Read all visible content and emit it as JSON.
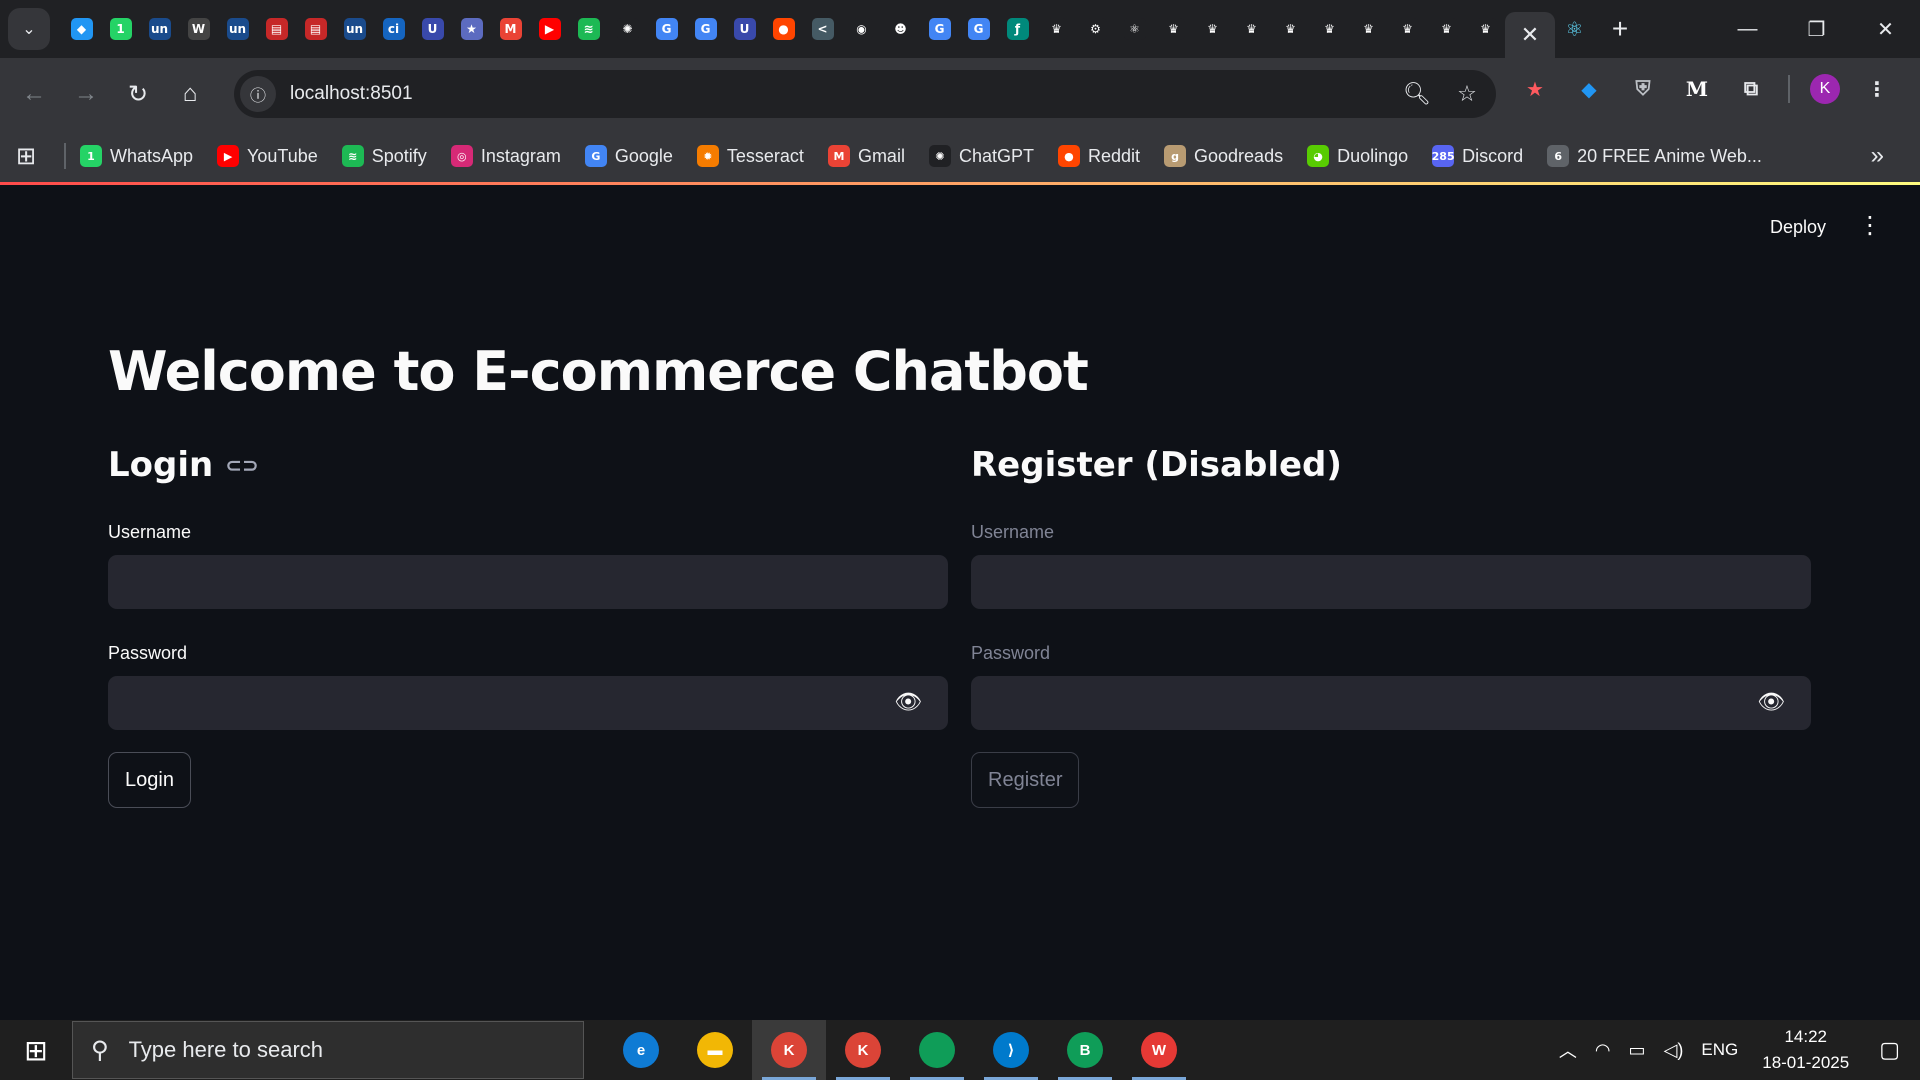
{
  "browser": {
    "pinned_tabs": [
      {
        "icon": "gem-icon",
        "glyph": "◆",
        "color": "#2196f3"
      },
      {
        "icon": "whatsapp-icon",
        "glyph": "1",
        "color": "#25d366"
      },
      {
        "icon": "un-icon",
        "glyph": "un",
        "color": "#1a4b8c"
      },
      {
        "icon": "wordpress-icon",
        "glyph": "W",
        "color": "#444"
      },
      {
        "icon": "un-icon",
        "glyph": "un",
        "color": "#1a4b8c"
      },
      {
        "icon": "doc-icon",
        "glyph": "▤",
        "color": "#c62828"
      },
      {
        "icon": "doc-icon",
        "glyph": "▤",
        "color": "#c62828"
      },
      {
        "icon": "un-icon",
        "glyph": "un",
        "color": "#1a4b8c"
      },
      {
        "icon": "citi-icon",
        "glyph": "ci",
        "color": "#1565c0"
      },
      {
        "icon": "bookmark-icon",
        "glyph": "U",
        "color": "#3949ab"
      },
      {
        "icon": "star-icon",
        "glyph": "★",
        "color": "#5c6bc0"
      },
      {
        "icon": "gmail-icon",
        "glyph": "M",
        "color": "#ea4335"
      },
      {
        "icon": "youtube-icon",
        "glyph": "▶",
        "color": "#ff0000"
      },
      {
        "icon": "spotify-icon",
        "glyph": "≋",
        "color": "#1db954"
      },
      {
        "icon": "chatgpt-icon",
        "glyph": "✺",
        "color": "#202124"
      },
      {
        "icon": "google-icon",
        "glyph": "G",
        "color": "#4285f4"
      },
      {
        "icon": "google-icon",
        "glyph": "G",
        "color": "#4285f4"
      },
      {
        "icon": "bookmark-icon",
        "glyph": "U",
        "color": "#3949ab"
      },
      {
        "icon": "reddit-icon",
        "glyph": "●",
        "color": "#ff4500"
      },
      {
        "icon": "share-icon",
        "glyph": "<",
        "color": "#455a64"
      },
      {
        "icon": "github-icon",
        "glyph": "◉",
        "color": "#202124"
      },
      {
        "icon": "lion-icon",
        "glyph": "☻",
        "color": "#202124"
      },
      {
        "icon": "google-icon",
        "glyph": "G",
        "color": "#4285f4"
      },
      {
        "icon": "google-icon",
        "glyph": "G",
        "color": "#4285f4"
      },
      {
        "icon": "feather-icon",
        "glyph": "ƒ",
        "color": "#00897b"
      },
      {
        "icon": "crown-icon",
        "glyph": "♛",
        "color": "#202124"
      },
      {
        "icon": "gear-icon",
        "glyph": "⚙",
        "color": "#202124"
      },
      {
        "icon": "react-icon",
        "glyph": "⚛",
        "color": "#202124"
      },
      {
        "icon": "crown-icon",
        "glyph": "♛",
        "color": "#202124"
      },
      {
        "icon": "crown-icon",
        "glyph": "♛",
        "color": "#202124"
      },
      {
        "icon": "crown-icon",
        "glyph": "♛",
        "color": "#202124"
      },
      {
        "icon": "crown-icon",
        "glyph": "♛",
        "color": "#202124"
      },
      {
        "icon": "crown-icon",
        "glyph": "♛",
        "color": "#202124"
      },
      {
        "icon": "crown-icon",
        "glyph": "♛",
        "color": "#202124"
      },
      {
        "icon": "crown-icon",
        "glyph": "♛",
        "color": "#202124"
      },
      {
        "icon": "crown-icon",
        "glyph": "♛",
        "color": "#202124"
      },
      {
        "icon": "crown-icon",
        "glyph": "♛",
        "color": "#202124"
      }
    ],
    "active_tab_close_glyph": "✕",
    "next_tab_glyph": "⚛",
    "new_tab_glyph": "+",
    "window": {
      "minimize": "—",
      "restore": "❐",
      "close": "✕"
    },
    "url": "localhost:8501",
    "extensions": [
      "★",
      "◆",
      "⛨",
      "M",
      "⧉"
    ],
    "profile_initial": "K",
    "bookmarks": [
      {
        "label": "WhatsApp",
        "glyph": "1",
        "color": "#25d366"
      },
      {
        "label": "YouTube",
        "glyph": "▶",
        "color": "#ff0000"
      },
      {
        "label": "Spotify",
        "glyph": "≋",
        "color": "#1db954"
      },
      {
        "label": "Instagram",
        "glyph": "◎",
        "color": "#d62976"
      },
      {
        "label": "Google",
        "glyph": "G",
        "color": "#4285f4"
      },
      {
        "label": "Tesseract",
        "glyph": "✹",
        "color": "#f57c00"
      },
      {
        "label": "Gmail",
        "glyph": "M",
        "color": "#ea4335"
      },
      {
        "label": "ChatGPT",
        "glyph": "✺",
        "color": "#202124"
      },
      {
        "label": "Reddit",
        "glyph": "●",
        "color": "#ff4500"
      },
      {
        "label": "Goodreads",
        "glyph": "g",
        "color": "#b89b72"
      },
      {
        "label": "Duolingo",
        "glyph": "◕",
        "color": "#58cc02"
      },
      {
        "label": "Discord",
        "glyph": "285",
        "color": "#5865f2"
      },
      {
        "label": "20 FREE Anime Web...",
        "glyph": "6",
        "color": "#5f6368"
      }
    ]
  },
  "app": {
    "deploy_label": "Deploy",
    "title": "Welcome to E-commerce Chatbot",
    "login": {
      "heading": "Login",
      "username_label": "Username",
      "username_value": "",
      "password_label": "Password",
      "password_value": "",
      "button_label": "Login"
    },
    "register": {
      "heading": "Register (Disabled)",
      "username_label": "Username",
      "username_value": "",
      "password_label": "Password",
      "password_value": "",
      "button_label": "Register"
    },
    "colors": {
      "accent_gradient_start": "#ff4b4b",
      "accent_gradient_end": "#fffd80",
      "background": "#0e1117",
      "input_bg": "#262730"
    }
  },
  "taskbar": {
    "search_placeholder": "Type here to search",
    "apps": [
      {
        "name": "edge",
        "glyph": "e",
        "color": "#0f7bd4"
      },
      {
        "name": "file-explorer",
        "glyph": "▬",
        "color": "#f2b705"
      },
      {
        "name": "chrome",
        "glyph": "K",
        "color": "#db4437"
      },
      {
        "name": "chrome",
        "glyph": "K",
        "color": "#db4437"
      },
      {
        "name": "chrome",
        "glyph": "",
        "color": "#0f9d58"
      },
      {
        "name": "vscode",
        "glyph": "⟩",
        "color": "#007acc"
      },
      {
        "name": "chrome",
        "glyph": "B",
        "color": "#0f9d58"
      },
      {
        "name": "wps-office",
        "glyph": "W",
        "color": "#e53935"
      }
    ],
    "language": "ENG",
    "time": "14:22",
    "date": "18-01-2025"
  }
}
